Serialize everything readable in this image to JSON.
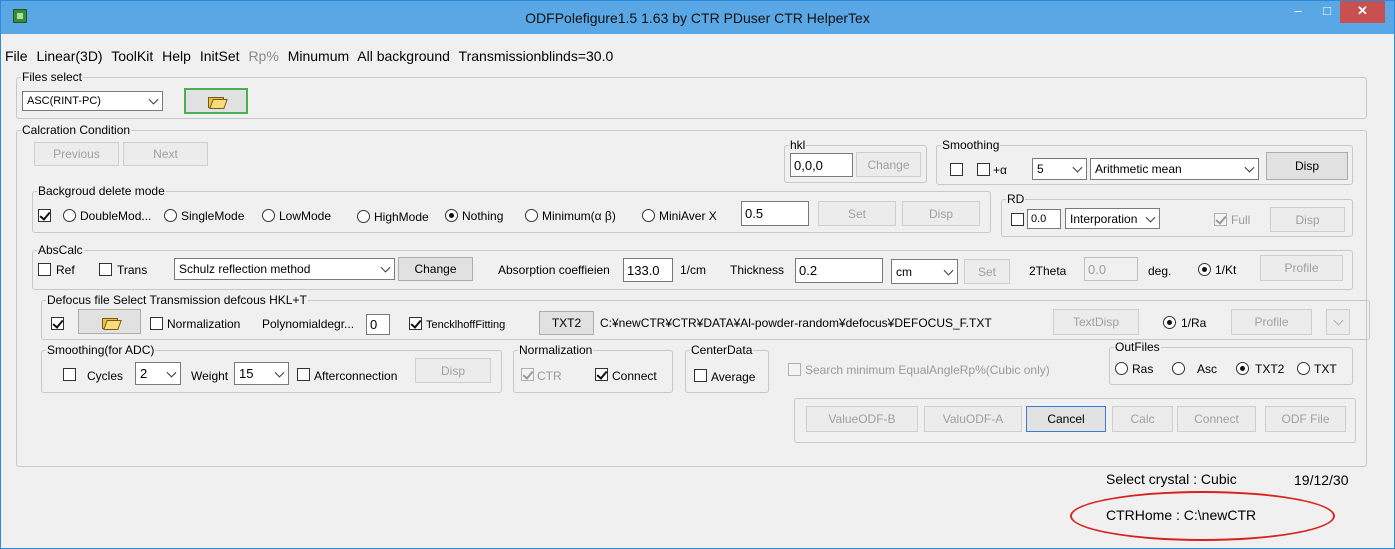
{
  "window": {
    "title": "ODFPolefigure1.5 1.63 by CTR PDuser CTR HelperTex",
    "min": "–",
    "max": "□",
    "close": "✕"
  },
  "menu": {
    "file": "File",
    "linear": "Linear(3D)",
    "toolkit": "ToolKit",
    "help": "Help",
    "initset": "InitSet",
    "rp": "Rp%",
    "minumum": "Minumum",
    "allbg": "All background",
    "transblinds": "Transmissionblinds=30.0"
  },
  "files": {
    "legend": "Files select",
    "format": "ASC(RINT-PC)"
  },
  "calc": {
    "legend": "Calcration Condition",
    "previous": "Previous",
    "next": "Next"
  },
  "hkl": {
    "legend": "hkl",
    "value": "0,0,0",
    "change": "Change"
  },
  "smoothing": {
    "legend": "Smoothing",
    "alpha": "+α",
    "n": "5",
    "method": "Arithmetic mean",
    "disp": "Disp"
  },
  "bgmode": {
    "legend": "Backgroud delete mode",
    "double": "DoubleMod...",
    "single": "SingleMode",
    "low": "LowMode",
    "high": "HighMode",
    "nothing": "Nothing",
    "minimum": "Minimum(α β)",
    "miniaver": "MiniAver X",
    "value": "0.5",
    "set": "Set",
    "disp": "Disp"
  },
  "rd": {
    "legend": "RD",
    "value": "0.0",
    "method": "Interporation",
    "full": "Full",
    "disp": "Disp"
  },
  "abscalc": {
    "legend": "AbsCalc",
    "ref": "Ref",
    "trans": "Trans",
    "method": "Schulz reflection method",
    "change": "Change",
    "abslabel": "Absorption coeffieien",
    "absvalue": "133.0",
    "absunit": "1/cm",
    "thicklabel": "Thickness",
    "thickvalue": "0.2",
    "thickunit": "cm",
    "set": "Set",
    "theta_label": "2Theta",
    "theta_value": "0.0",
    "deg": "deg.",
    "kt": "1/Kt",
    "profile": "Profile"
  },
  "defocus": {
    "legend": "Defocus file Select Transmission defcous HKL+T",
    "normalization": "Normalization",
    "polylabel": "Polynomialdegr...",
    "polyvalue": "0",
    "tenck": "TencklhoffFitting",
    "txt2": "TXT2",
    "path": "C:¥newCTR¥CTR¥DATA¥Al-powder-random¥defocus¥DEFOCUS_F.TXT",
    "textdisp": "TextDisp",
    "ra": "1/Ra",
    "profile": "Profile"
  },
  "adc": {
    "legend": "Smoothing(for ADC)",
    "cycles": "Cycles",
    "cycles_value": "2",
    "weight": "Weight",
    "weight_value": "15",
    "afterconn": "Afterconnection",
    "disp": "Disp"
  },
  "norm": {
    "legend": "Normalization",
    "ctr": "CTR",
    "connect": "Connect"
  },
  "center": {
    "legend": "CenterData",
    "average": "Average"
  },
  "search": {
    "label": "Search minimum EqualAngleRp%(Cubic only)"
  },
  "outfiles": {
    "legend": "OutFiles",
    "ras": "Ras",
    "asc": "Asc",
    "txt2": "TXT2",
    "txt": "TXT"
  },
  "actions": {
    "valueb": "ValueODF-B",
    "valuea": "ValuODF-A",
    "cancel": "Cancel",
    "calc": "Calc",
    "connect": "Connect",
    "odffile": "ODF File"
  },
  "status": {
    "crystal": "Select crystal : Cubic",
    "date": "19/12/30",
    "home": "CTRHome : C:\\newCTR"
  },
  "colors": {
    "titlebar": "#5aa7e6",
    "close": "#c75050",
    "highlight": "#4caf50",
    "ellipse": "#d8241f"
  }
}
